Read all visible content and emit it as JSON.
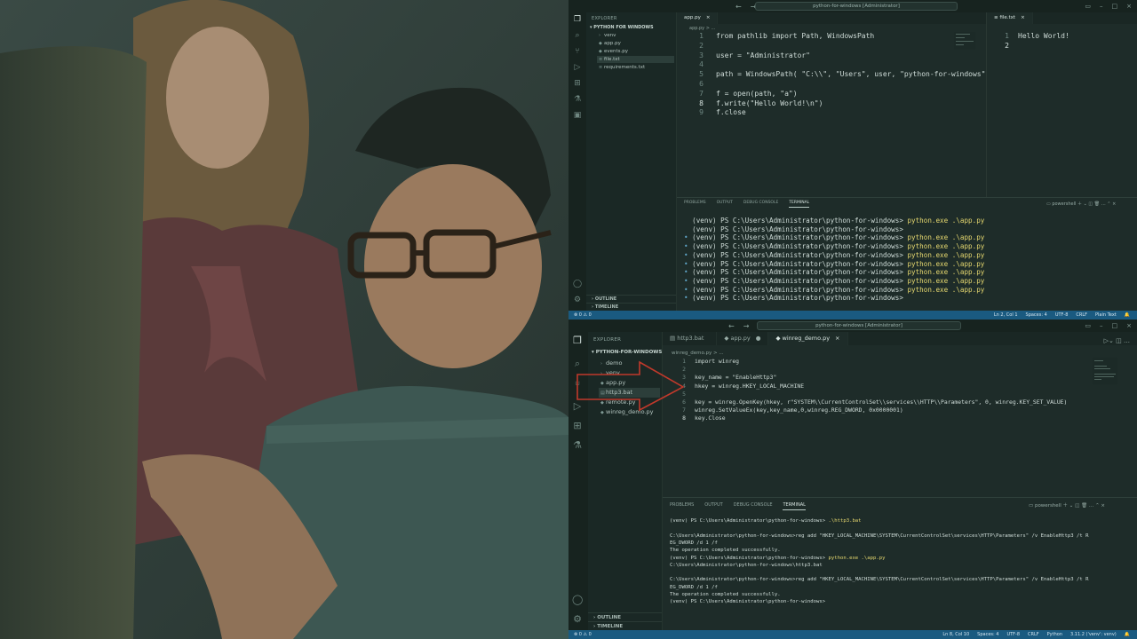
{
  "window_top": {
    "title": "python-for-windows [Administrator]",
    "sidebar": {
      "header": "EXPLORER",
      "project": "PYTHON FOR WINDOWS",
      "files": [
        "venv",
        "app.py",
        "events.py",
        "file.txt",
        "requirements.txt"
      ],
      "outline": "OUTLINE",
      "timeline": "TIMELINE"
    },
    "tabs": [
      {
        "label": "app.py",
        "close": "×"
      },
      {
        "label": "file.txt",
        "close": "×"
      }
    ],
    "breadcrumb": "app.py > ...",
    "code": [
      {
        "n": "1",
        "t": "from pathlib import Path, WindowsPath"
      },
      {
        "n": "2",
        "t": ""
      },
      {
        "n": "3",
        "t": "user = \"Administrator\""
      },
      {
        "n": "4",
        "t": ""
      },
      {
        "n": "5",
        "t": "path = WindowsPath( \"C:\\\\\", \"Users\", user, \"python-for-windows\""
      },
      {
        "n": "6",
        "t": ""
      },
      {
        "n": "7",
        "t": "f = open(path, \"a\")"
      },
      {
        "n": "8",
        "t": "f.write(\"Hello World!\\n\")"
      },
      {
        "n": "9",
        "t": "f.close"
      }
    ],
    "file_txt": [
      {
        "n": "1",
        "t": "Hello World!"
      },
      {
        "n": "2",
        "t": ""
      }
    ],
    "panel_tabs": [
      "PROBLEMS",
      "OUTPUT",
      "DEBUG CONSOLE",
      "TERMINAL"
    ],
    "terminal_shell": "powershell",
    "terminal": [
      {
        "dot": "",
        "prompt": "(venv) PS C:\\Users\\Administrator\\python-for-windows> ",
        "cmd": "python.exe .\\app.py"
      },
      {
        "dot": "",
        "prompt": "(venv) PS C:\\Users\\Administrator\\python-for-windows> ",
        "cmd": ""
      },
      {
        "dot": "•",
        "prompt": "(venv) PS C:\\Users\\Administrator\\python-for-windows> ",
        "cmd": "python.exe .\\app.py"
      },
      {
        "dot": "•",
        "prompt": "(venv) PS C:\\Users\\Administrator\\python-for-windows> ",
        "cmd": "python.exe .\\app.py"
      },
      {
        "dot": "•",
        "prompt": "(venv) PS C:\\Users\\Administrator\\python-for-windows> ",
        "cmd": "python.exe .\\app.py"
      },
      {
        "dot": "•",
        "prompt": "(venv) PS C:\\Users\\Administrator\\python-for-windows> ",
        "cmd": "python.exe .\\app.py"
      },
      {
        "dot": "•",
        "prompt": "(venv) PS C:\\Users\\Administrator\\python-for-windows> ",
        "cmd": "python.exe .\\app.py"
      },
      {
        "dot": "•",
        "prompt": "(venv) PS C:\\Users\\Administrator\\python-for-windows> ",
        "cmd": "python.exe .\\app.py"
      },
      {
        "dot": "•",
        "prompt": "(venv) PS C:\\Users\\Administrator\\python-for-windows> ",
        "cmd": "python.exe .\\app.py"
      },
      {
        "dot": "•",
        "prompt": "(venv) PS C:\\Users\\Administrator\\python-for-windows> ",
        "cmd": ""
      }
    ],
    "status_left": "⊗ 0 ⚠ 0",
    "status_right": [
      "Ln 2, Col 1",
      "Spaces: 4",
      "UTF-8",
      "CRLF",
      "Plain Text"
    ]
  },
  "window_bottom": {
    "title": "python-for-windows [Administrator]",
    "sidebar": {
      "header": "EXPLORER",
      "project": "PYTHON-FOR-WINDOWS",
      "files": [
        "demo",
        "venv",
        "app.py",
        "http3.bat",
        "remote.py",
        "winreg_demo.py"
      ],
      "outline": "OUTLINE",
      "timeline": "TIMELINE"
    },
    "tabs": [
      {
        "label": "http3.bat",
        "close": ""
      },
      {
        "label": "app.py",
        "close": "●"
      },
      {
        "label": "winreg_demo.py",
        "close": "×"
      }
    ],
    "breadcrumb": "winreg_demo.py > ...",
    "code": [
      {
        "n": "1",
        "t": "import winreg"
      },
      {
        "n": "2",
        "t": ""
      },
      {
        "n": "3",
        "t": "key_name = \"EnableHttp3\""
      },
      {
        "n": "4",
        "t": "hkey = winreg.HKEY_LOCAL_MACHINE"
      },
      {
        "n": "5",
        "t": ""
      },
      {
        "n": "6",
        "t": "key = winreg.OpenKey(hkey, r\"SYSTEM\\\\CurrentControlSet\\\\services\\\\HTTP\\\\Parameters\", 0, winreg.KEY_SET_VALUE)"
      },
      {
        "n": "7",
        "t": "winreg.SetValueEx(key,key_name,0,winreg.REG_DWORD, 0x0000001)"
      },
      {
        "n": "8",
        "t": "key.Close"
      }
    ],
    "panel_tabs": [
      "PROBLEMS",
      "OUTPUT",
      "DEBUG CONSOLE",
      "TERMINAL"
    ],
    "terminal_shell": "powershell",
    "terminal": [
      {
        "prompt": "(venv) PS C:\\Users\\Administrator\\python-for-windows> ",
        "cmd": ".\\http3.bat"
      },
      {
        "prompt": "",
        "cmd": ""
      },
      {
        "prompt": "C:\\Users\\Administrator\\python-for-windows>reg add \"HKEY_LOCAL_MACHINE\\SYSTEM\\CurrentControlSet\\services\\HTTP\\Parameters\" /v EnableHttp3 /t R",
        "cmd": ""
      },
      {
        "prompt": "EG_DWORD /d 1 /f",
        "cmd": ""
      },
      {
        "prompt": "The operation completed successfully.",
        "cmd": ""
      },
      {
        "prompt": "(venv) PS C:\\Users\\Administrator\\python-for-windows> ",
        "cmd": "python.exe .\\app.py"
      },
      {
        "prompt": "C:\\Users\\Administrator\\python-for-windows\\http3.bat",
        "cmd": ""
      },
      {
        "prompt": "",
        "cmd": ""
      },
      {
        "prompt": "C:\\Users\\Administrator\\python-for-windows>reg add \"HKEY_LOCAL_MACHINE\\SYSTEM\\CurrentControlSet\\services\\HTTP\\Parameters\" /v EnableHttp3 /t R",
        "cmd": ""
      },
      {
        "prompt": "EG_DWORD /d 1 /f",
        "cmd": ""
      },
      {
        "prompt": "The operation completed successfully.",
        "cmd": ""
      },
      {
        "prompt": "(venv) PS C:\\Users\\Administrator\\python-for-windows> ",
        "cmd": ""
      }
    ],
    "status_left": "⊗ 0 ⚠ 0",
    "status_right": [
      "Ln 8, Col 10",
      "Spaces: 4",
      "UTF-8",
      "CRLF",
      "Python",
      "3.11.2 ('venv': venv)"
    ]
  },
  "colors": {
    "status_bar": "#1a5a80",
    "arrow": "#c0392b",
    "terminal_command": "#e6d86f"
  }
}
